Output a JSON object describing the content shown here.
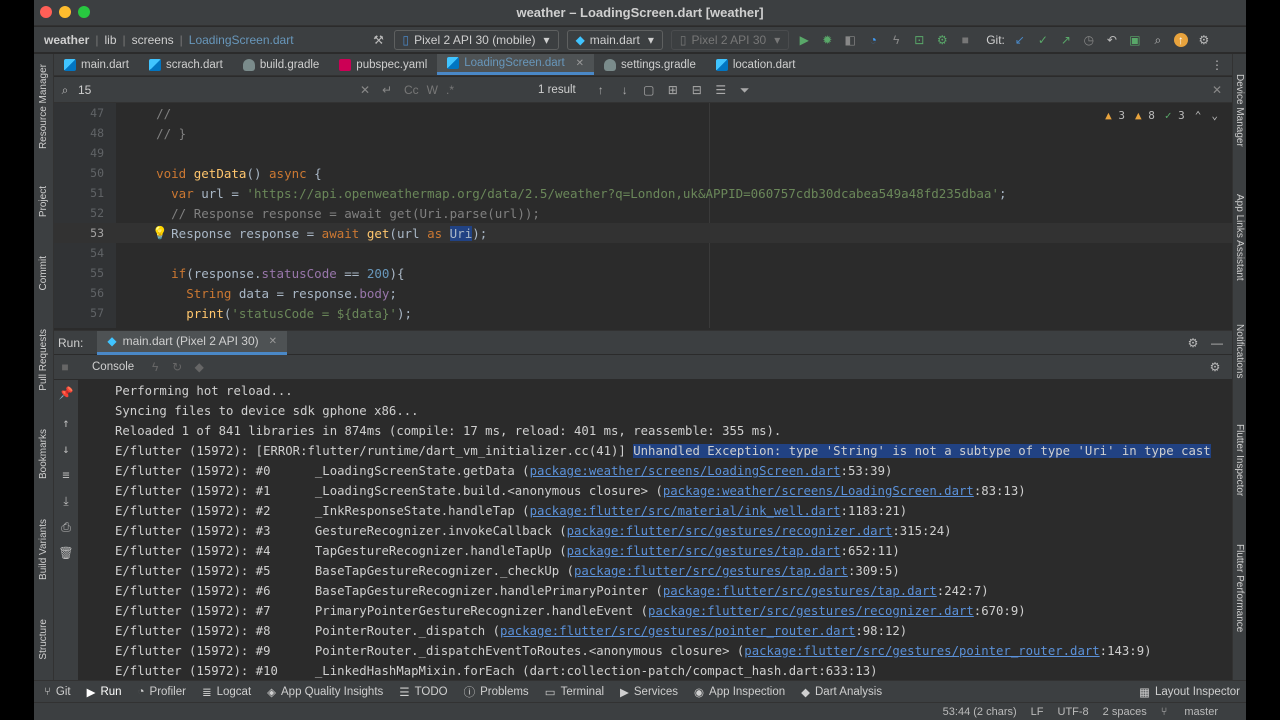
{
  "window": {
    "title": "weather – LoadingScreen.dart [weather]"
  },
  "breadcrumbs": [
    "weather",
    "lib",
    "screens",
    "LoadingScreen.dart"
  ],
  "toolbar": {
    "device": "Pixel 2 API 30 (mobile)",
    "run_config": "main.dart",
    "avd": "Pixel 2 API 30",
    "git_label": "Git:"
  },
  "tabs": [
    {
      "label": "main.dart",
      "icon": "dart-file-icon"
    },
    {
      "label": "scrach.dart",
      "icon": "dart-file-icon"
    },
    {
      "label": "build.gradle",
      "icon": "gradle-icon"
    },
    {
      "label": "pubspec.yaml",
      "icon": "yaml-icon"
    },
    {
      "label": "LoadingScreen.dart",
      "icon": "dart-file-icon",
      "active": true
    },
    {
      "label": "settings.gradle",
      "icon": "gradle-icon"
    },
    {
      "label": "location.dart",
      "icon": "dart-file-icon"
    }
  ],
  "search": {
    "value": "15",
    "result": "1 result"
  },
  "inspections": {
    "warnings": "3",
    "weak_warnings": "8",
    "typos": "3"
  },
  "code_lines": [
    {
      "num": "47",
      "text": "    //"
    },
    {
      "num": "48",
      "text": "    // }"
    },
    {
      "num": "49",
      "text": ""
    },
    {
      "num": "50",
      "text": "    void getData() async {"
    },
    {
      "num": "51",
      "text": "      var url = 'https://api.openweathermap.org/data/2.5/weather?q=London,uk&APPID=060757cdb30dcabea549a48fd235dbaa';"
    },
    {
      "num": "52",
      "text": "      // Response response = await get(Uri.parse(url));"
    },
    {
      "num": "53",
      "text": "      Response response = await get(url as Uri);"
    },
    {
      "num": "54",
      "text": ""
    },
    {
      "num": "55",
      "text": "      if(response.statusCode == 200){"
    },
    {
      "num": "56",
      "text": "        String data = response.body;"
    },
    {
      "num": "57",
      "text": "        print('statusCode = ${data}');"
    }
  ],
  "run": {
    "label": "Run:",
    "tab": "main.dart (Pixel 2 API 30)",
    "console_label": "Console"
  },
  "console_lines": [
    {
      "text": "Performing hot reload..."
    },
    {
      "text": "Syncing files to device sdk gphone x86..."
    },
    {
      "text": "Reloaded 1 of 841 libraries in 874ms (compile: 17 ms, reload: 401 ms, reassemble: 355 ms)."
    },
    {
      "prefix": "E/flutter (15972): [ERROR:flutter/runtime/dart_vm_initializer.cc(41)] ",
      "selected": "Unhandled Exception: type 'String' is not a subtype of type 'Uri' in type cast"
    },
    {
      "prefix": "E/flutter (15972): #0      _LoadingScreenState.getData (",
      "link": "package:weather/screens/LoadingScreen.dart",
      "suffix": ":53:39)"
    },
    {
      "prefix": "E/flutter (15972): #1      _LoadingScreenState.build.<anonymous closure> (",
      "link": "package:weather/screens/LoadingScreen.dart",
      "suffix": ":83:13)"
    },
    {
      "prefix": "E/flutter (15972): #2      _InkResponseState.handleTap (",
      "link": "package:flutter/src/material/ink_well.dart",
      "suffix": ":1183:21)"
    },
    {
      "prefix": "E/flutter (15972): #3      GestureRecognizer.invokeCallback (",
      "link": "package:flutter/src/gestures/recognizer.dart",
      "suffix": ":315:24)"
    },
    {
      "prefix": "E/flutter (15972): #4      TapGestureRecognizer.handleTapUp (",
      "link": "package:flutter/src/gestures/tap.dart",
      "suffix": ":652:11)"
    },
    {
      "prefix": "E/flutter (15972): #5      BaseTapGestureRecognizer._checkUp (",
      "link": "package:flutter/src/gestures/tap.dart",
      "suffix": ":309:5)"
    },
    {
      "prefix": "E/flutter (15972): #6      BaseTapGestureRecognizer.handlePrimaryPointer (",
      "link": "package:flutter/src/gestures/tap.dart",
      "suffix": ":242:7)"
    },
    {
      "prefix": "E/flutter (15972): #7      PrimaryPointerGestureRecognizer.handleEvent (",
      "link": "package:flutter/src/gestures/recognizer.dart",
      "suffix": ":670:9)"
    },
    {
      "prefix": "E/flutter (15972): #8      PointerRouter._dispatch (",
      "link": "package:flutter/src/gestures/pointer_router.dart",
      "suffix": ":98:12)"
    },
    {
      "prefix": "E/flutter (15972): #9      PointerRouter._dispatchEventToRoutes.<anonymous closure> (",
      "link": "package:flutter/src/gestures/pointer_router.dart",
      "suffix": ":143:9)"
    },
    {
      "prefix": "E/flutter (15972): #10     _LinkedHashMapMixin.forEach (dart:collection-patch/compact_hash.dart:633:13)"
    }
  ],
  "left_strip": [
    "Resource Manager",
    "Project",
    "Commit",
    "Pull Requests",
    "Bookmarks",
    "Build Variants",
    "Structure"
  ],
  "right_strip": [
    "Device Manager",
    "App Links Assistant",
    "Notifications",
    "Flutter Inspector",
    "Flutter Performance"
  ],
  "tool_windows": [
    {
      "label": "Git",
      "icon": "git-icon"
    },
    {
      "label": "Run",
      "icon": "run-icon",
      "active": true
    },
    {
      "label": "Profiler",
      "icon": "profiler-icon"
    },
    {
      "label": "Logcat",
      "icon": "logcat-icon"
    },
    {
      "label": "App Quality Insights",
      "icon": "app-quality-icon"
    },
    {
      "label": "TODO",
      "icon": "todo-icon"
    },
    {
      "label": "Problems",
      "icon": "problems-icon"
    },
    {
      "label": "Terminal",
      "icon": "terminal-icon"
    },
    {
      "label": "Services",
      "icon": "services-icon"
    },
    {
      "label": "App Inspection",
      "icon": "app-inspection-icon"
    },
    {
      "label": "Dart Analysis",
      "icon": "dart-analysis-icon"
    }
  ],
  "layout_inspector": "Layout Inspector",
  "status": {
    "position": "53:44 (2 chars)",
    "line_sep": "LF",
    "encoding": "UTF-8",
    "indent": "2 spaces",
    "branch": "master"
  }
}
